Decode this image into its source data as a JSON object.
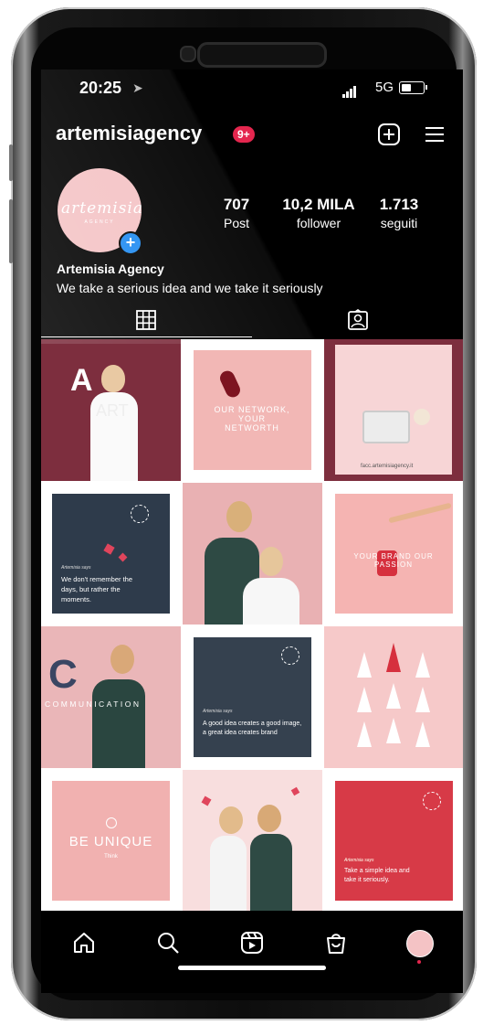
{
  "status": {
    "time": "20:25",
    "network": "5G"
  },
  "profile": {
    "username": "artemisiagency",
    "notification_badge": "9+",
    "avatar_logo": "artemisia",
    "avatar_logo_sub": "AGENCY",
    "display_name": "Artemisia Agency",
    "bio": "We take a serious idea and we take it seriously",
    "stats": [
      {
        "value": "707",
        "label": "Post"
      },
      {
        "value": "10,2 MILA",
        "label": "follower"
      },
      {
        "value": "1.713",
        "label": "seguiti"
      }
    ]
  },
  "tabs": [
    {
      "icon": "grid-icon",
      "active": true
    },
    {
      "icon": "tagged-icon",
      "active": false
    }
  ],
  "posts": [
    {
      "kind": "photo",
      "bg": "#7d2e3e",
      "text": "ART",
      "letter": "A"
    },
    {
      "kind": "graphic",
      "bg": "#f2b7b5",
      "text": "OUR NETWORK, YOUR NETWORTH"
    },
    {
      "kind": "photo",
      "bg": "#f7d5d6",
      "text": "facc.artemisiagency.it"
    },
    {
      "kind": "quote",
      "bg": "#2e3b4b",
      "script": "Artemisia says",
      "text": "We don't remember the days, but rather the moments."
    },
    {
      "kind": "photo",
      "bg": "#e9b1b3",
      "text": ""
    },
    {
      "kind": "graphic",
      "bg": "#f5b4b2",
      "text": "YOUR BRAND OUR PASSION"
    },
    {
      "kind": "photo",
      "bg": "#eab6b8",
      "text": "COMMUNICATION",
      "letter": "C"
    },
    {
      "kind": "quote",
      "bg": "#35414f",
      "script": "Artemisia says",
      "text": "A good idea creates a good image, a great idea creates brand"
    },
    {
      "kind": "photo",
      "bg": "#f6c9c9",
      "text": ""
    },
    {
      "kind": "graphic",
      "bg": "#f1b1b0",
      "text": "BE UNIQUE",
      "sub": "Think"
    },
    {
      "kind": "photo",
      "bg": "#f8dede",
      "text": ""
    },
    {
      "kind": "quote",
      "bg": "#d73a47",
      "script": "Artemisia says",
      "text": "Take a simple idea and take it seriously."
    }
  ],
  "bottom_nav": [
    "home-icon",
    "search-icon",
    "reels-icon",
    "shop-icon",
    "profile-avatar"
  ],
  "colors": {
    "background": "#000000",
    "badge": "#e4264e",
    "accent": "#1f8bf2"
  }
}
